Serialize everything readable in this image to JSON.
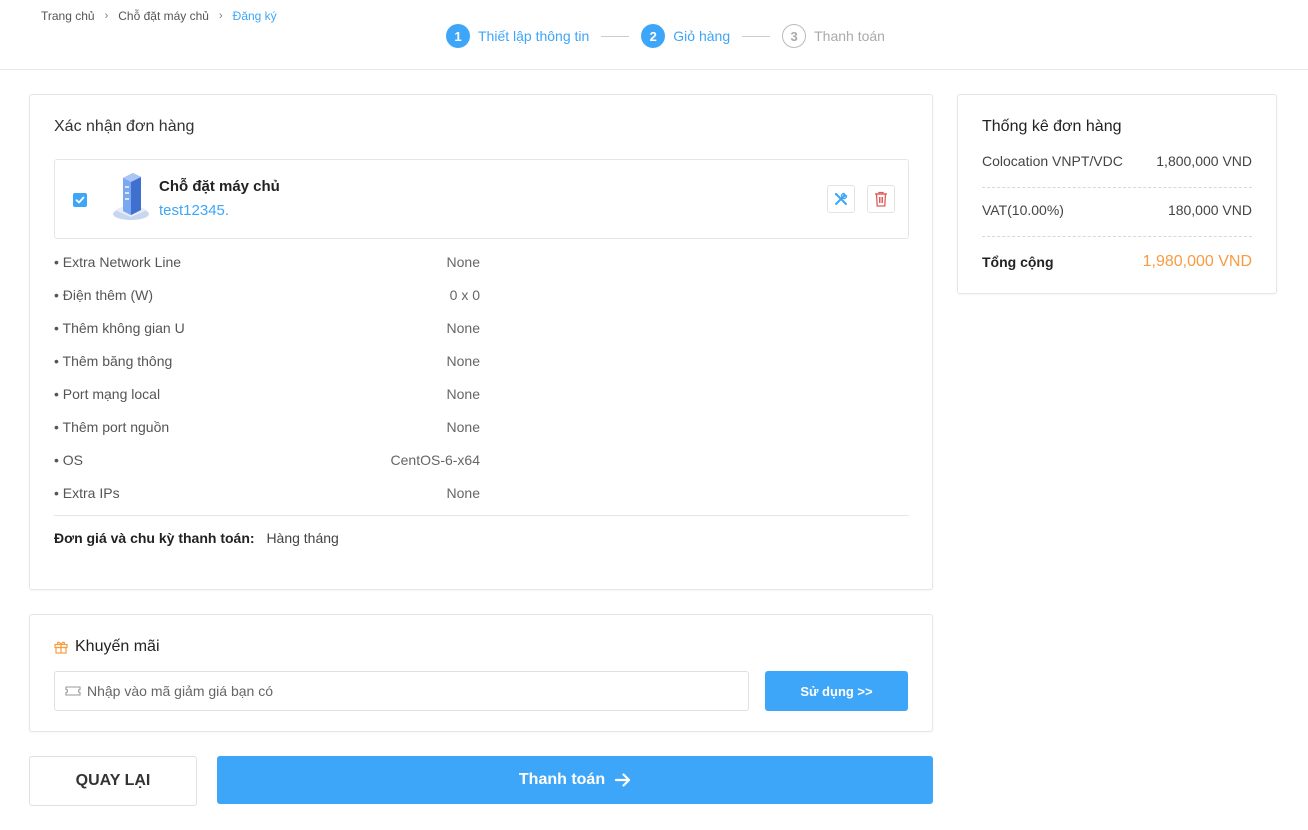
{
  "breadcrumb": {
    "home": "Trang chủ",
    "section": "Chỗ đặt máy chủ",
    "current": "Đăng ký"
  },
  "steps": [
    {
      "num": "1",
      "label": "Thiết lập thông tin"
    },
    {
      "num": "2",
      "label": "Giỏ hàng"
    },
    {
      "num": "3",
      "label": "Thanh toán"
    }
  ],
  "order": {
    "title": "Xác nhận đơn hàng",
    "product_name": "Chỗ đặt máy chủ",
    "hostname": "test12345.",
    "checked": true,
    "specs": [
      {
        "label": "• Extra Network Line",
        "value": "None"
      },
      {
        "label": "• Điện thêm (W)",
        "value": "0 x 0"
      },
      {
        "label": "• Thêm không gian U",
        "value": "None"
      },
      {
        "label": "• Thêm băng thông",
        "value": "None"
      },
      {
        "label": "• Port mạng local",
        "value": "None"
      },
      {
        "label": "• Thêm port nguồn",
        "value": "None"
      },
      {
        "label": "• OS",
        "value": "CentOS-6-x64"
      },
      {
        "label": "• Extra IPs",
        "value": "None"
      }
    ],
    "cycle_label": "Đơn giá và chu kỳ thanh toán:",
    "cycle_value": "Hàng tháng"
  },
  "promo": {
    "title": "Khuyến mãi",
    "placeholder": "Nhập vào mã giảm giá bạn có",
    "button": "Sử dụng >>"
  },
  "actions": {
    "back": "QUAY LẠI",
    "pay": "Thanh toán"
  },
  "summary": {
    "title": "Thống kê đơn hàng",
    "items": [
      {
        "label": "Colocation VNPT/VDC",
        "value": "1,800,000 VND"
      },
      {
        "label": "VAT(10.00%)",
        "value": "180,000 VND"
      }
    ],
    "total_label": "Tổng cộng",
    "total_value": "1,980,000 VND"
  },
  "colors": {
    "accent": "#3ea6f8",
    "total": "#f79c42",
    "delete": "#e05a5a"
  }
}
